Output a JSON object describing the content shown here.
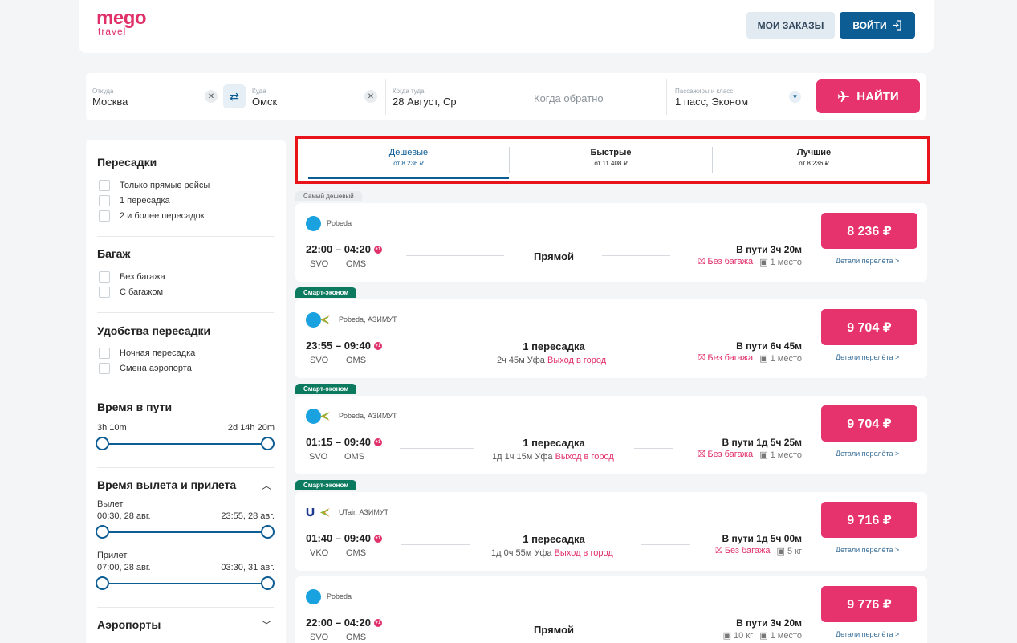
{
  "header": {
    "logo_line1": "mego",
    "logo_line2": "travel",
    "orders_label": "МОИ ЗАКАЗЫ",
    "login_label": "ВОЙТИ"
  },
  "search": {
    "from_label": "Откуда",
    "from_value": "Москва",
    "to_label": "Куда",
    "to_value": "Омск",
    "depart_label": "Когда туда",
    "depart_value": "28 Август, Ср",
    "return_placeholder": "Когда обратно",
    "pax_label": "Пассажиры и класс",
    "pax_value": "1 пасс, Эконом",
    "find_label": "НАЙТИ"
  },
  "filters": {
    "transfers_title": "Пересадки",
    "transfers": [
      "Только прямые рейсы",
      "1 пересадка",
      "2 и более пересадок"
    ],
    "baggage_title": "Багаж",
    "baggage": [
      "Без багажа",
      "С багажом"
    ],
    "comfort_title": "Удобства пересадки",
    "comfort": [
      "Ночная пересадка",
      "Смена аэропорта"
    ],
    "travel_time_title": "Время в пути",
    "travel_time_min": "3h 10m",
    "travel_time_max": "2d 14h 20m",
    "dep_arr_title": "Время вылета и прилета",
    "departure_label": "Вылет",
    "departure_min": "00:30, 28 авг.",
    "departure_max": "23:55, 28 авг.",
    "arrival_label": "Прилет",
    "arrival_min": "07:00, 28 авг.",
    "arrival_max": "03:30, 31 авг.",
    "airports_title": "Аэропорты"
  },
  "tabs": [
    {
      "label": "Дешевые",
      "price": "от 8 236 ₽"
    },
    {
      "label": "Быстрые",
      "price": "от 11 408 ₽"
    },
    {
      "label": "Лучшие",
      "price": "от 8 236 ₽"
    }
  ],
  "details_label": "Детали перелёта >",
  "flights": [
    {
      "badge": "Самый дешевый",
      "airline": "Pobeda",
      "times": "22:00 – 04:20",
      "dep": "SVO",
      "arr": "OMS",
      "stops": "Прямой",
      "via": "",
      "exit": "",
      "duration": "В пути 3ч 20м",
      "bag": "Без багажа",
      "hand": "1 место",
      "price": "8 236 ₽"
    },
    {
      "badge": "Смарт-эконом",
      "airline": "Pobeda, АЗИМУТ",
      "times": "23:55 – 09:40",
      "dep": "SVO",
      "arr": "OMS",
      "stops": "1 пересадка",
      "via": "2ч 45м Уфа",
      "exit": "Выход в город",
      "duration": "В пути 6ч 45м",
      "bag": "Без багажа",
      "hand": "1 место",
      "price": "9 704 ₽"
    },
    {
      "badge": "Смарт-эконом",
      "airline": "Pobeda, АЗИМУТ",
      "times": "01:15 – 09:40",
      "dep": "SVO",
      "arr": "OMS",
      "stops": "1 пересадка",
      "via": "1д 1ч 15м Уфа",
      "exit": "Выход в город",
      "duration": "В пути 1д 5ч 25м",
      "bag": "Без багажа",
      "hand": "1 место",
      "price": "9 704 ₽"
    },
    {
      "badge": "Смарт-эконом",
      "airline": "UTair, АЗИМУТ",
      "times": "01:40 – 09:40",
      "dep": "VKO",
      "arr": "OMS",
      "stops": "1 пересадка",
      "via": "1д 0ч 55м Уфа",
      "exit": "Выход в город",
      "duration": "В пути 1д 5ч 00м",
      "bag": "Без багажа",
      "hand": "5 кг",
      "price": "9 716 ₽"
    },
    {
      "badge": "",
      "airline": "Pobeda",
      "times": "22:00 – 04:20",
      "dep": "SVO",
      "arr": "OMS",
      "stops": "Прямой",
      "via": "",
      "exit": "",
      "duration": "В пути 3ч 20м",
      "bag": "10 кг",
      "hand": "1 место",
      "price": "9 776 ₽"
    }
  ]
}
